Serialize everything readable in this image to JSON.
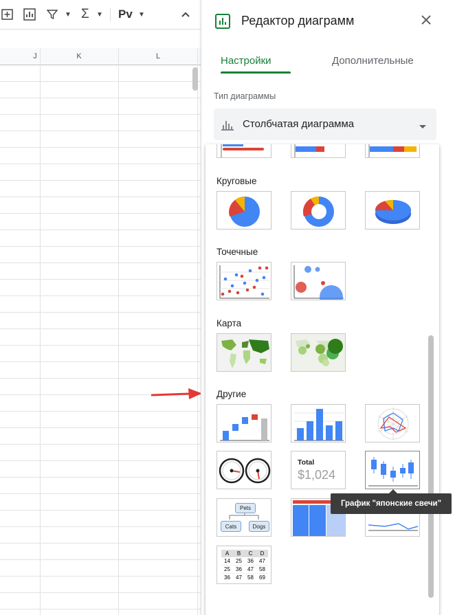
{
  "toolbar": {
    "sum_symbol": "Σ",
    "font_label": "Рv"
  },
  "columns": [
    "J",
    "K",
    "L"
  ],
  "panel": {
    "title": "Редактор диаграмм",
    "tabs": [
      {
        "label": "Настройки",
        "active": true
      },
      {
        "label": "Дополнительные",
        "active": false
      }
    ],
    "chart_type_label": "Тип диаграммы",
    "chart_type_value": "Столбчатая диаграмма"
  },
  "dropdown": {
    "sections": [
      {
        "label": "Круговые"
      },
      {
        "label": "Точечные"
      },
      {
        "label": "Карта"
      },
      {
        "label": "Другие"
      }
    ],
    "scorecard": {
      "title": "Total",
      "value": "$1,024"
    },
    "org": {
      "root": "Pets",
      "left": "Cats",
      "right": "Dogs"
    },
    "table": {
      "header": [
        "A",
        "B",
        "C",
        "D"
      ],
      "rows": [
        [
          "14",
          "25",
          "36",
          "47"
        ],
        [
          "25",
          "36",
          "47",
          "58"
        ],
        [
          "36",
          "47",
          "58",
          "69"
        ]
      ]
    }
  },
  "tooltip": "График \"японские свечи\"",
  "colors": {
    "accent": "#188038",
    "blue": "#4285f4",
    "red": "#db4437",
    "yellow": "#f4b400",
    "arrow": "#e53935",
    "map_green": "#2e7d1a"
  }
}
